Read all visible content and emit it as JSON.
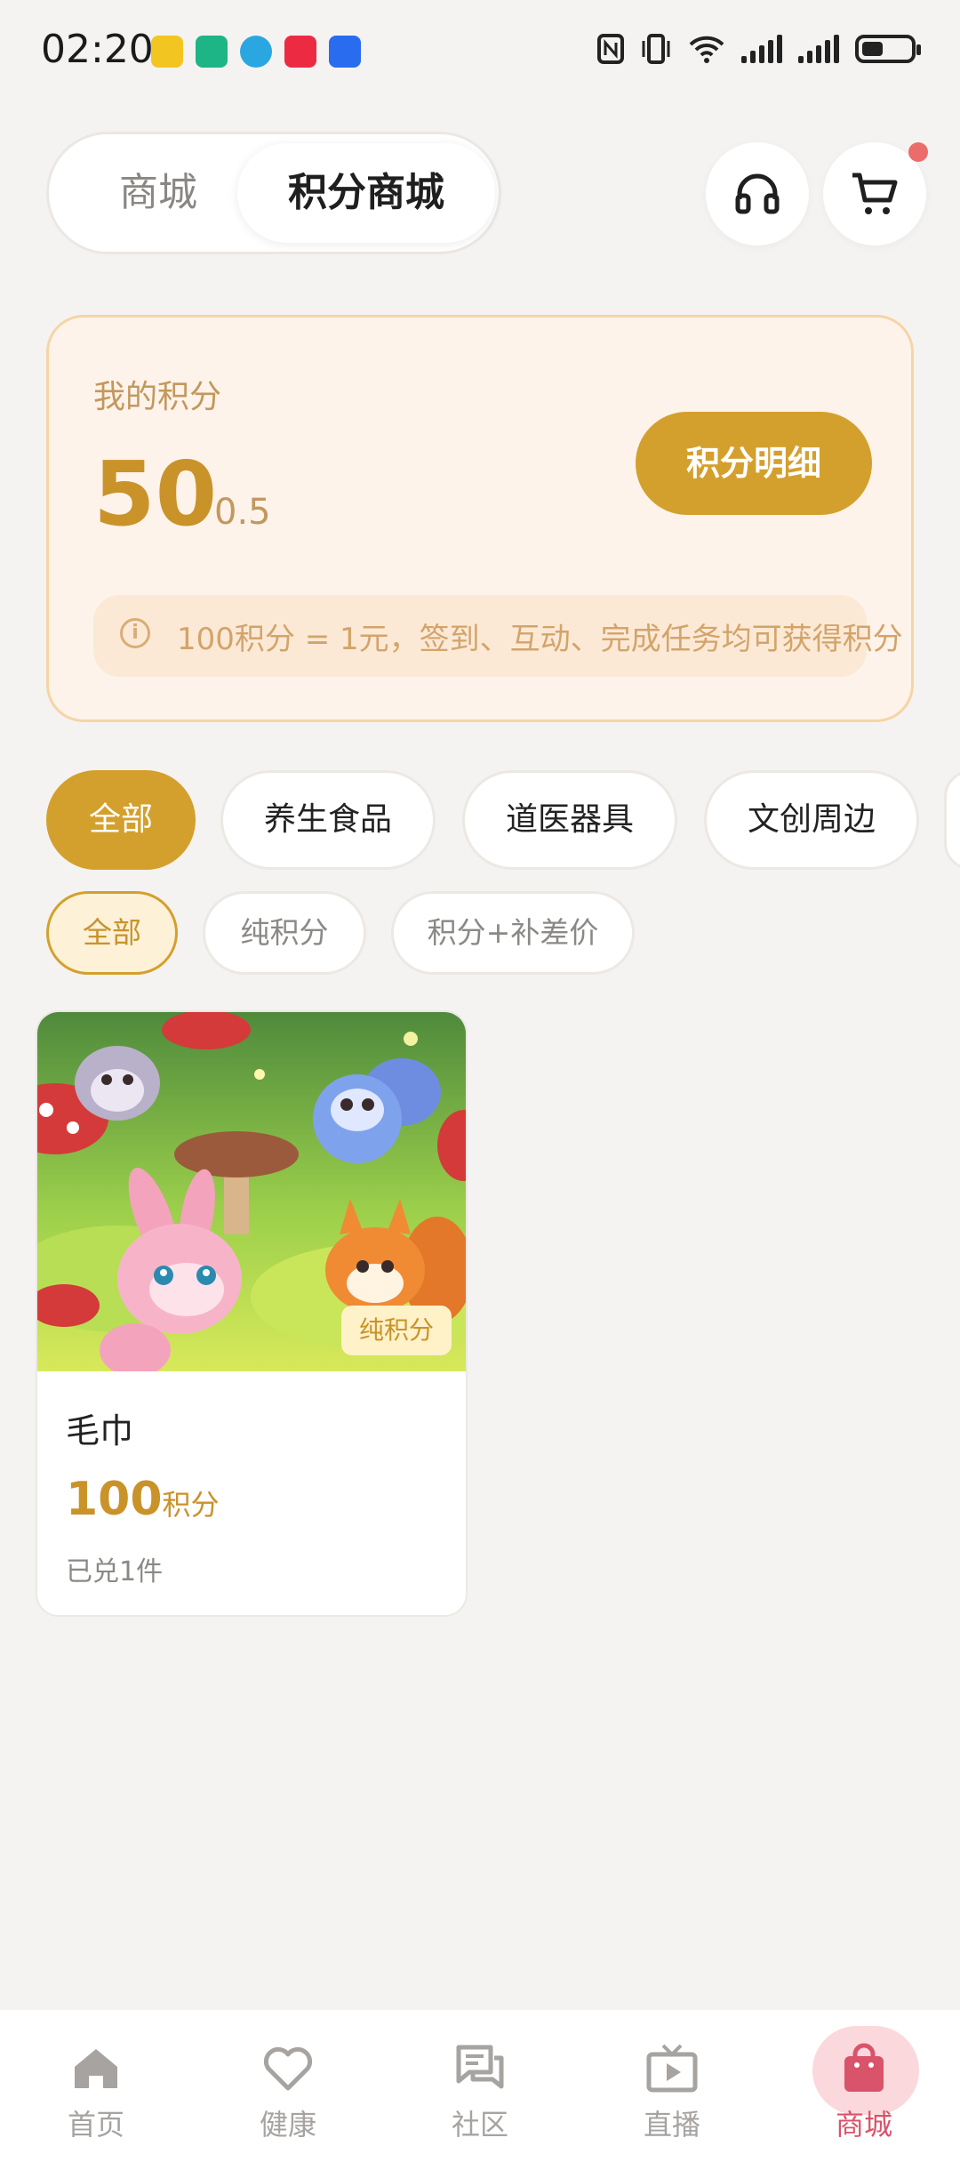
{
  "status": {
    "time": "02:20",
    "app_icons": [
      "game-app",
      "wechat-mini",
      "paper-plane-app",
      "xiaohongshu-app",
      "light-bulb-app"
    ],
    "battery_level": 0.45
  },
  "header": {
    "tabs": [
      {
        "label": "商城",
        "selected": false
      },
      {
        "label": "积分商城",
        "selected": true
      }
    ],
    "cart_badge": true
  },
  "points": {
    "title": "我的积分",
    "value": "50",
    "decimal": "0.5",
    "detail_button": "积分明细",
    "tip": "100积分 = 1元，签到、互动、完成任务均可获得积分"
  },
  "categories": [
    {
      "label": "全部",
      "active": true
    },
    {
      "label": "养生食品",
      "active": false
    },
    {
      "label": "道医器具",
      "active": false
    },
    {
      "label": "文创周边",
      "active": false
    }
  ],
  "filters": [
    {
      "label": "全部",
      "active": true
    },
    {
      "label": "纯积分",
      "active": false
    },
    {
      "label": "积分+补差价",
      "active": false
    }
  ],
  "products": [
    {
      "name": "毛巾",
      "price": "100",
      "unit": "积分",
      "sold": "已兑1件",
      "badge": "纯积分"
    }
  ],
  "nav": [
    {
      "label": "首页",
      "icon": "home-icon",
      "active": false
    },
    {
      "label": "健康",
      "icon": "heart-icon",
      "active": false
    },
    {
      "label": "社区",
      "icon": "chat-icon",
      "active": false
    },
    {
      "label": "直播",
      "icon": "tv-icon",
      "active": false
    },
    {
      "label": "商城",
      "icon": "shopping-bag-icon",
      "active": true
    }
  ],
  "colors": {
    "accent_gold": "#d4a02d",
    "card_bg": "#fdf3ea",
    "nav_active": "#d9536a",
    "badge_red": "#ec6b6b"
  }
}
